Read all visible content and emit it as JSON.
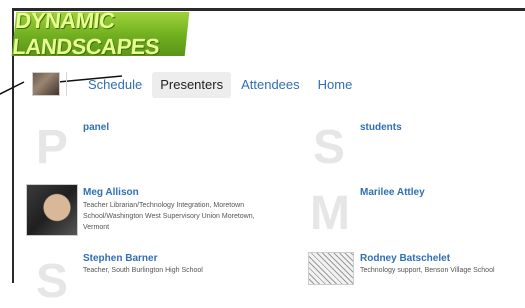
{
  "logo": {
    "text": "DYNAMIC LANDSCAPES"
  },
  "nav": {
    "items": [
      {
        "label": "Schedule"
      },
      {
        "label": "Presenters"
      },
      {
        "label": "Attendees"
      },
      {
        "label": "Home"
      }
    ],
    "active": "Presenters"
  },
  "presenters": [
    {
      "letter": "P",
      "name": "panel",
      "description": ""
    },
    {
      "letter": "S",
      "name": "students",
      "description": ""
    },
    {
      "letter": "",
      "name": "Meg Allison",
      "description": "Teacher Librarian/Technology Integration, Moretown School/Washington West Supervisory Union Moretown, Vermont"
    },
    {
      "letter": "M",
      "name": "Marilee Attley",
      "description": ""
    },
    {
      "letter": "S",
      "name": "Stephen Barner",
      "description": "Teacher, South Burlington High School"
    },
    {
      "letter": "",
      "name": "Rodney Batschelet",
      "description": "Technology support, Benson Village School"
    }
  ],
  "colors": {
    "link": "#2f6fb5",
    "logo_green": "#6fae1f",
    "active_tab_bg": "#ededed"
  }
}
